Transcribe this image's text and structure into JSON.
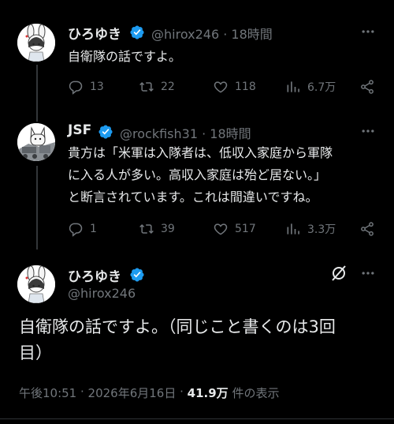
{
  "tweets": [
    {
      "name": "ひろゆき",
      "handle": "@hirox246",
      "time": "18時間",
      "text_lines": [
        "自衛隊の話ですよ。"
      ],
      "replies": "13",
      "retweets": "22",
      "likes": "118",
      "views": "6.7万"
    },
    {
      "name": "JSF",
      "handle": "@rockfish31",
      "time": "18時間",
      "text_lines": [
        "貴方は「米軍は入隊者は、低収入家庭から軍隊",
        "に入る人が多い。高収入家庭は殆ど居ない。」",
        "と断言されています。これは間違いですね。"
      ],
      "replies": "1",
      "retweets": "39",
      "likes": "517",
      "views": "3.3万"
    }
  ],
  "main": {
    "name": "ひろゆき",
    "handle": "@hirox246",
    "text_lines": [
      "自衛隊の話ですよ。（同じこと書くのは3回",
      "目）"
    ],
    "time": "午後10:51",
    "date": "2026年6月16日",
    "views": "41.9万",
    "views_suffix": "件の表示"
  },
  "colors": {
    "background": "#000000",
    "text": "#e7e9ea",
    "secondary": "#71767b",
    "verified": "#1d9bf0"
  },
  "icons": [
    "reply-icon",
    "retweet-icon",
    "like-icon",
    "views-icon",
    "share-icon",
    "more-icon",
    "verified-icon",
    "grok-icon"
  ]
}
